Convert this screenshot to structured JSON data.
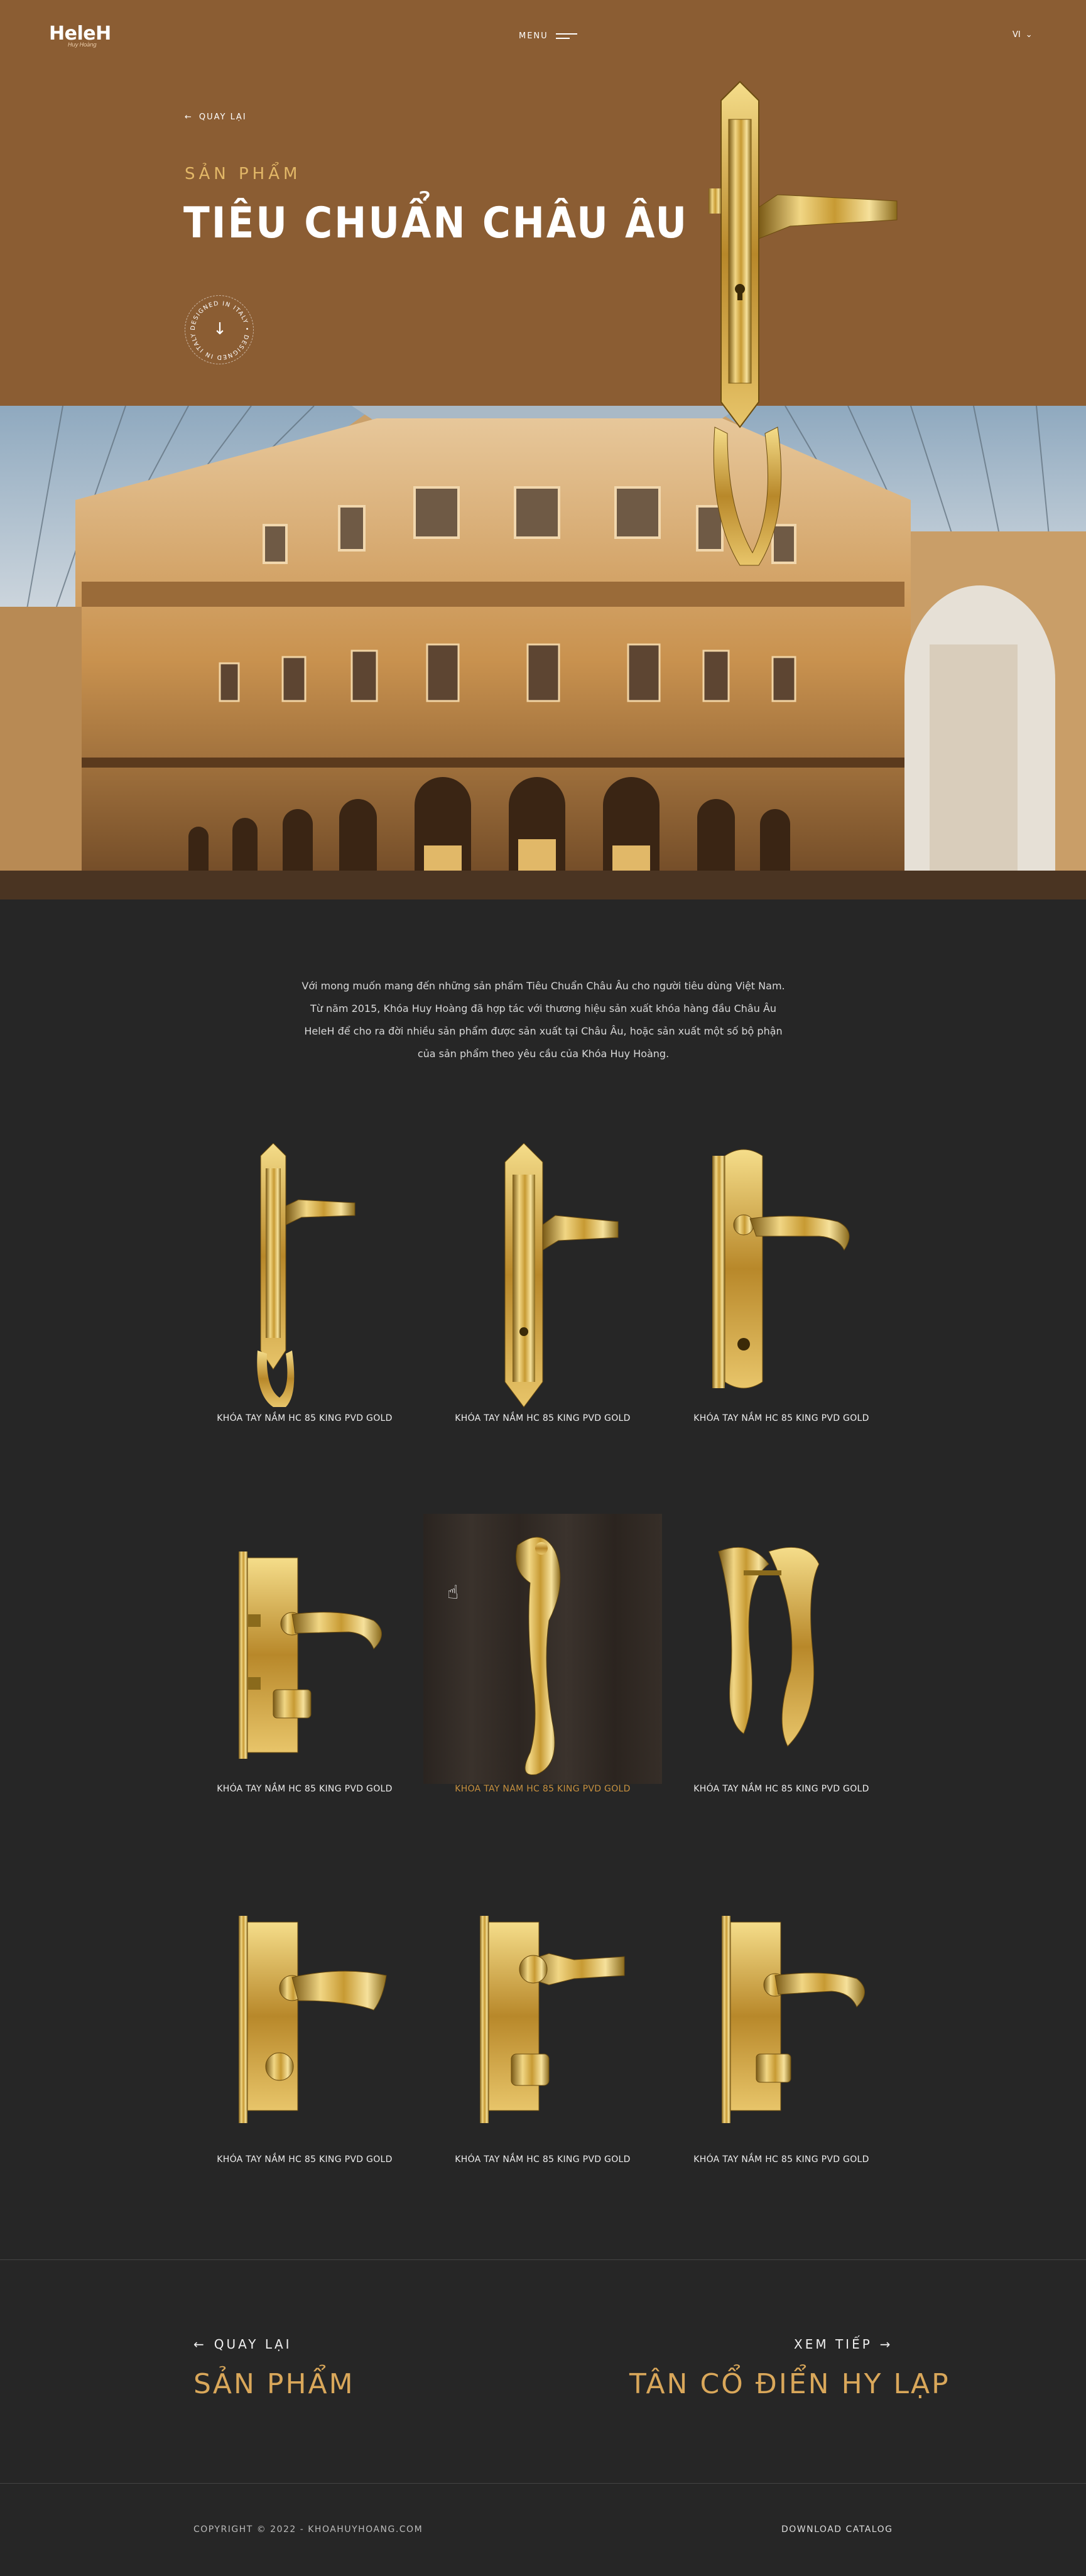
{
  "header": {
    "logo": "HeleH",
    "logo_tagline": "Huy Hoàng",
    "menu_label": "MENU",
    "language": "VI"
  },
  "hero": {
    "back_label": "QUAY LẠI",
    "subtitle": "SẢN PHẨM",
    "title": "TIÊU CHUẨN CHÂU ÂU",
    "badge_text": "DESIGNED IN ITALY • DESIGNED IN ITALY •",
    "badge_arrow": "↓"
  },
  "intro": {
    "lines": [
      "Với mong muốn mang đến những sản phẩm Tiêu Chuẩn Châu Âu cho người tiêu dùng Việt Nam.",
      "Từ năm 2015, Khóa Huy Hoàng đã hợp tác với thương hiệu sản xuất khóa hàng đầu Châu Âu",
      "HeleH để cho ra đời nhiều sản phẩm được sản xuất tại Châu Âu, hoặc sản xuất một số bộ phận",
      "của sản phẩm theo yêu cầu của Khóa Huy Hoàng."
    ]
  },
  "products": [
    {
      "caption": "KHÓA TAY NẮM HC 85 KING PVD GOLD"
    },
    {
      "caption": "KHÓA TAY NẮM HC 85 KING PVD GOLD"
    },
    {
      "caption": "KHÓA TAY NẮM HC 85 KING PVD GOLD"
    },
    {
      "caption": "KHÓA TAY NẮM HC 85 KING PVD GOLD"
    },
    {
      "caption": "KHÓA TAY NẮM HC 85 KING PVD GOLD"
    },
    {
      "caption": "KHÓA TAY NẮM HC 85 KING PVD GOLD"
    },
    {
      "caption": "KHÓA TAY NẮM HC 85 KING PVD GOLD"
    },
    {
      "caption": "KHÓA TAY NẮM HC 85 KING PVD GOLD"
    },
    {
      "caption": "KHÓA TAY NẮM HC 85 KING PVD GOLD"
    }
  ],
  "bottom_nav": {
    "prev_label": "QUAY LẠI",
    "prev_title": "SẢN PHẨM",
    "next_label": "XEM TIẾP",
    "next_title": "TÂN CỔ ĐIỂN HY LẠP"
  },
  "footer": {
    "copyright": "COPYRIGHT © 2022 - KHOAHUYHOANG.COM",
    "download": "DOWNLOAD CATALOG"
  },
  "colors": {
    "hero_bg": "#8b5d33",
    "page_bg": "#262626",
    "accent_gold": "#d9a75a",
    "subtitle_gold": "#e2b767"
  }
}
